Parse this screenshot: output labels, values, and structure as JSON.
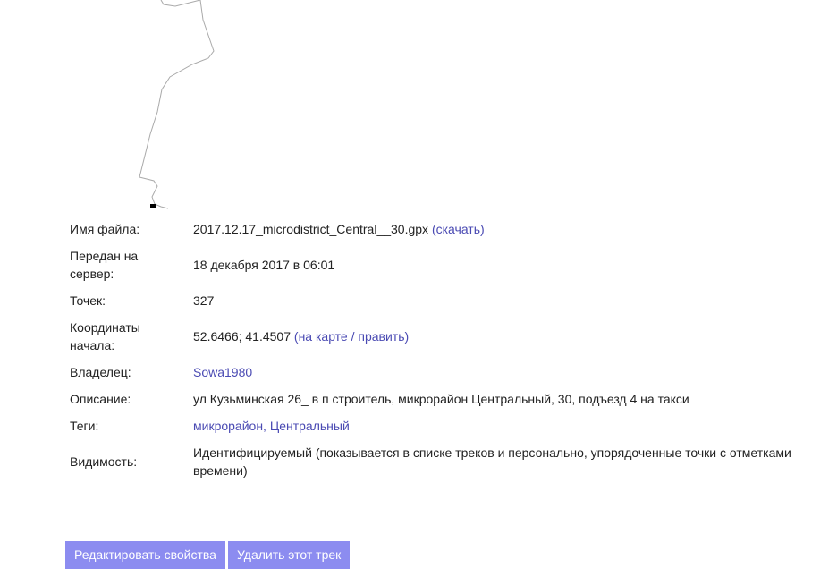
{
  "track": {
    "file_name_label": "Имя файла:",
    "file_name": "2017.12.17_microdistrict_Central__30.gpx",
    "download_label": "скачать",
    "uploaded_label": "Передан на сервер:",
    "uploaded": "18 декабря 2017 в 06:01",
    "points_label": "Точек:",
    "points": "327",
    "start_label": "Координаты начала:",
    "start_coords": "52.6466; 41.4507",
    "on_map_label": "на карте",
    "edit_label": "править",
    "owner_label": "Владелец:",
    "owner": "Sowa1980",
    "description_label": "Описание:",
    "description": "ул Кузьминская 26_ в п строитель, микрорайон Центральный, 30, подъезд 4 на такси",
    "tags_label": "Теги:",
    "tags": "микрорайон, Центральный",
    "visibility_label": "Видимость:",
    "visibility": "Идентифицируемый (показывается в списке треков и персонально, упорядоченные точки с отметками времени)"
  },
  "actions": {
    "edit_button": "Редактировать свойства",
    "delete_button": "Удалить этот трек"
  },
  "colors": {
    "link": "#4a4ab3",
    "button_bg": "#8c8cf0",
    "track_line": "#aaaaaa"
  }
}
